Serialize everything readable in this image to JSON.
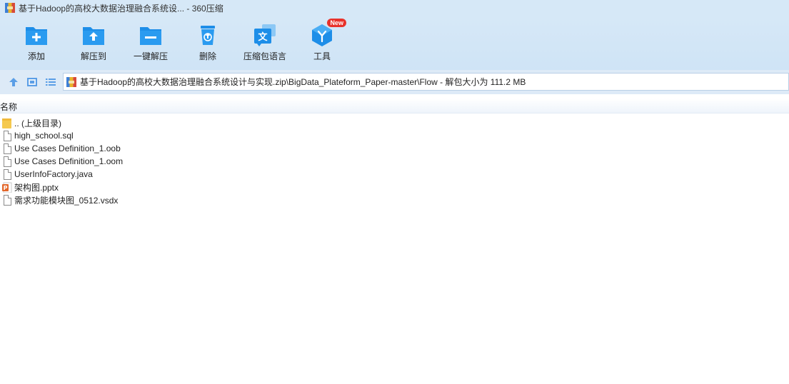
{
  "window": {
    "title": "基于Hadoop的高校大数据治理融合系统设... - 360压缩"
  },
  "toolbar": {
    "add": "添加",
    "extract_to": "解压到",
    "one_click_extract": "一键解压",
    "delete": "删除",
    "archive_language": "压缩包语言",
    "tools": "工具",
    "tools_badge": "New"
  },
  "addressbar": {
    "path": "基于Hadoop的高校大数据治理融合系统设计与实现.zip\\BigData_Plateform_Paper-master\\Flow - 解包大小为 111.2 MB"
  },
  "columns": {
    "name": "名称"
  },
  "files": [
    {
      "name": ".. (上级目录)",
      "icon": "folder-icon"
    },
    {
      "name": "high_school.sql",
      "icon": "file-icon"
    },
    {
      "name": "Use Cases Definition_1.oob",
      "icon": "file-icon"
    },
    {
      "name": "Use Cases Definition_1.oom",
      "icon": "file-icon"
    },
    {
      "name": "UserInfoFactory.java",
      "icon": "file-icon"
    },
    {
      "name": "架构图.pptx",
      "icon": "pptx-icon"
    },
    {
      "name": "需求功能模块图_0512.vsdx",
      "icon": "file-icon"
    }
  ],
  "colors": {
    "toolbar_bg": "#d6e8f7",
    "icon_blue": "#1d8ee8",
    "badge_red": "#e8322b",
    "pptx_orange": "#e3672b"
  }
}
